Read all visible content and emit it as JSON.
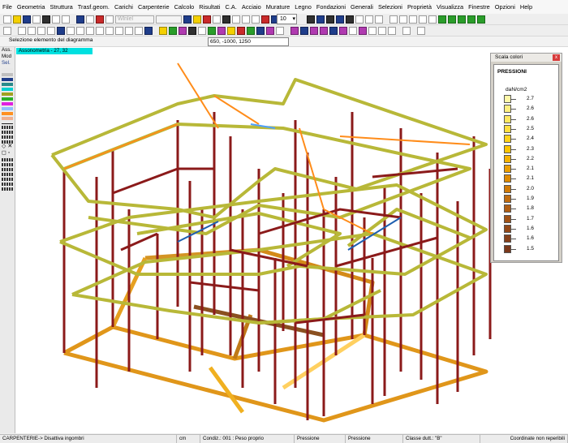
{
  "menu": [
    "File",
    "Geometria",
    "Struttura",
    "Trasf.geom.",
    "Carichi",
    "Carpenterie",
    "Calcolo",
    "Risultati",
    "C.A.",
    "Acciaio",
    "Murature",
    "Legno",
    "Fondazioni",
    "Generali",
    "Selezioni",
    "Proprietà",
    "Visualizza",
    "Finestre",
    "Opzioni",
    "Help"
  ],
  "toolbar": {
    "combo_value": "10",
    "disabled_label": "Wlnlel"
  },
  "selection_label": "Selezione  elemento del diagramma",
  "coord_input_value": "650, -1000, 1250",
  "canvas": {
    "view_label": "Assonometria  -  27, 32"
  },
  "left_panel": {
    "ass_label": "Ass.",
    "mod_label": "Mod",
    "sel_label": "Sel."
  },
  "color_scale": {
    "window_title": "Scala colori",
    "close_glyph": "x",
    "heading": "PRESSIONI",
    "unit": "daN/cm2",
    "values": [
      "2.7",
      "2.6",
      "2.6",
      "2.5",
      "2.4",
      "2.3",
      "2.2",
      "2.1",
      "2.1",
      "2.0",
      "1.9",
      "1.8",
      "1.7",
      "1.6",
      "1.6",
      "1.5"
    ],
    "colors": [
      "#fff7a8",
      "#ffef80",
      "#ffe860",
      "#ffde40",
      "#ffd21a",
      "#fcc400",
      "#f4b200",
      "#ea9e00",
      "#de8a00",
      "#d07a08",
      "#c06c10",
      "#b05e14",
      "#a15216",
      "#934818",
      "#86401a",
      "#7a381a"
    ]
  },
  "status": {
    "mode": "CARPENTERIE-> Disattiva ingombri",
    "units": "cm",
    "condition": "Condiz.: 001 : Peso proprio",
    "result1": "Pressione",
    "result2": "Pressione",
    "ductility": "Classe dutt.: \"B\"",
    "coords": "Coordinate non reperibili"
  },
  "colors": {
    "frame_yellow": "#b8b838",
    "column_red": "#8b1a1a",
    "beam_orange": "#ff8c1a",
    "bracing_blue": "#1f5fb0",
    "foundation_orange": "#e59a1a",
    "axon_label_bg": "#00e0e0"
  }
}
